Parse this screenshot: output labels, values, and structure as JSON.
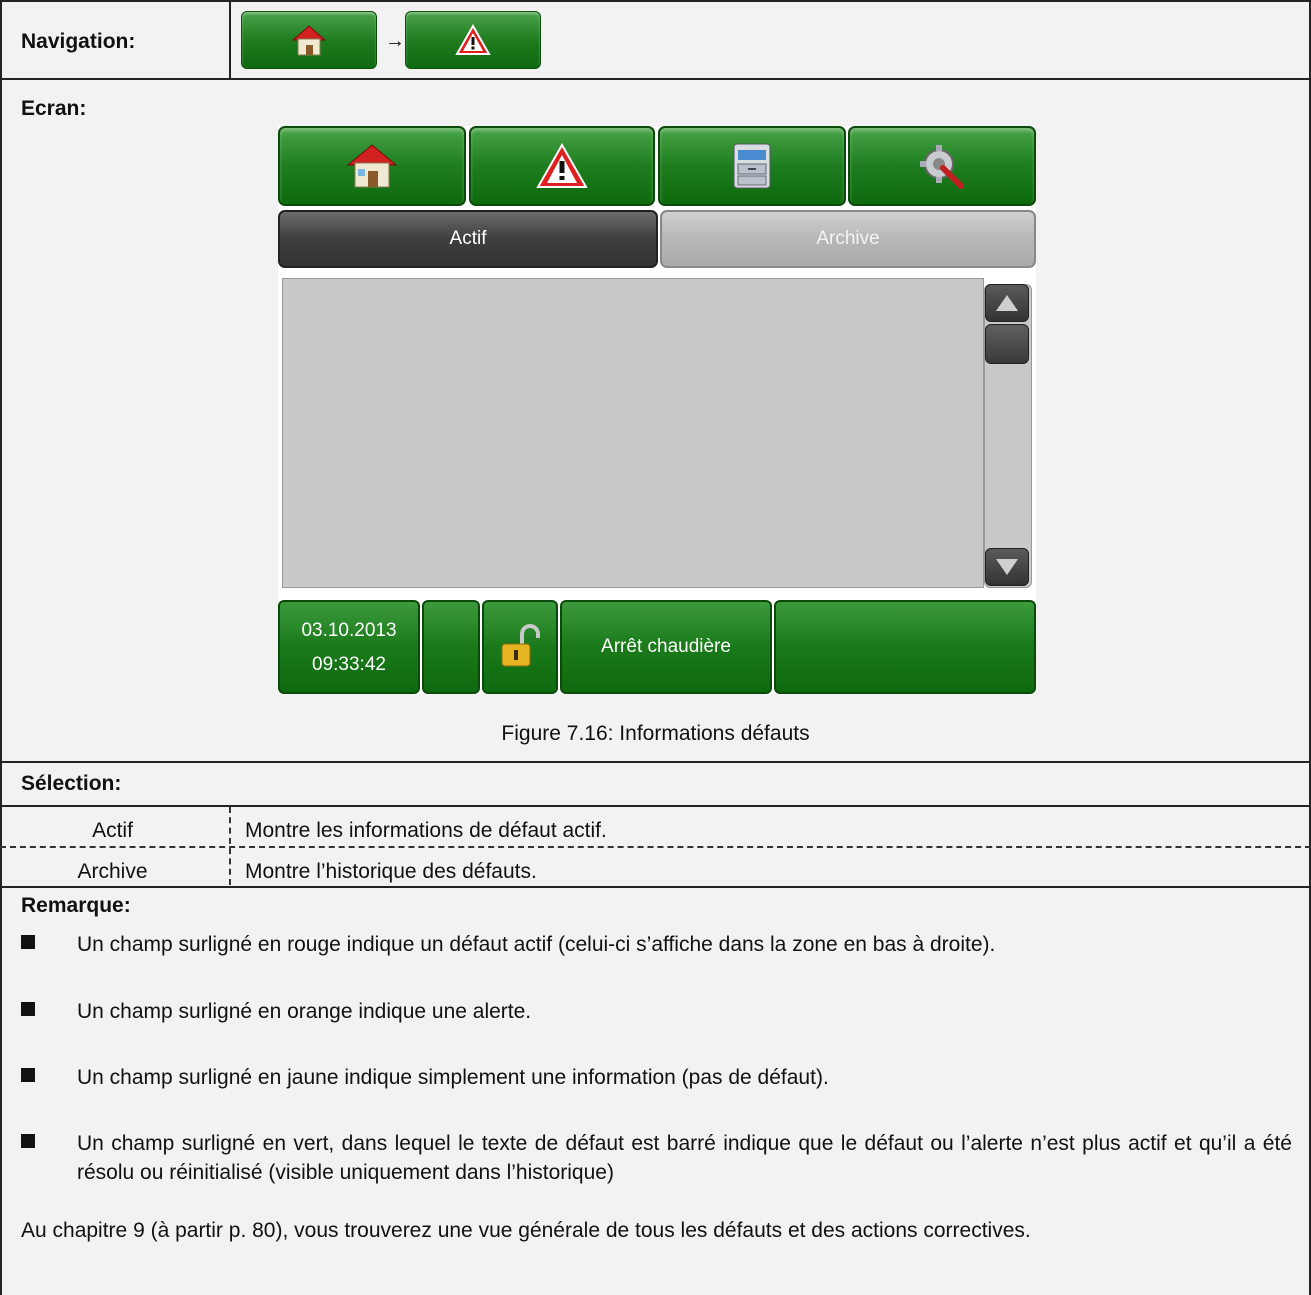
{
  "navigation": {
    "label": "Navigation:",
    "arrow": "→",
    "buttons": [
      "home-icon",
      "warning-icon"
    ]
  },
  "screen_section": {
    "label": "Ecran:"
  },
  "hmi": {
    "toolbar_icons": [
      "home-icon",
      "warning-icon",
      "archive-drawer-icon",
      "settings-tools-icon"
    ],
    "tabs": {
      "active": "Actif",
      "inactive": "Archive"
    },
    "status": {
      "date": "03.10.2013",
      "time": "09:33:42",
      "lock_icon": "unlocked-padlock-icon",
      "message": "Arrêt chaudière"
    },
    "colors": {
      "button_green": "#1e7d1e",
      "list_bg": "#c9c9c9",
      "tab_active": "#3e3e3e"
    }
  },
  "caption": "Figure 7.16: Informations défauts",
  "selection": {
    "label": "Sélection:",
    "rows": [
      {
        "name": "Actif",
        "desc": "Montre les informations de défaut actif."
      },
      {
        "name": "Archive",
        "desc": "Montre l’historique des défauts."
      }
    ]
  },
  "remarks": {
    "label": "Remarque:",
    "bullets": [
      "Un champ surligné en rouge indique un défaut actif (celui-ci s’affiche dans la zone en bas à droite).",
      "Un champ surligné en orange indique une alerte.",
      "Un champ surligné en jaune indique simplement une information (pas de défaut).",
      "Un champ surligné en vert, dans lequel le texte de défaut est barré indique que le défaut ou l’alerte n’est plus actif et qu’il a été résolu ou réinitialisé (visible uniquement dans l’historique)"
    ],
    "note": "Au chapitre 9 (à partir p. 80), vous trouverez une vue générale de tous les défauts et des actions correctives."
  }
}
